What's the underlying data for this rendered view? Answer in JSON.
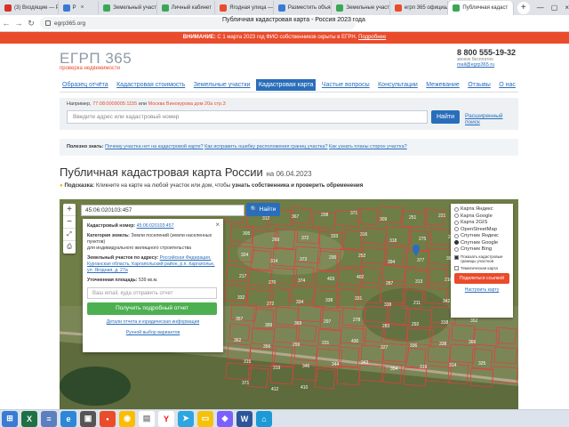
{
  "browser": {
    "tabs": [
      {
        "label": "(3) Входящие — Р",
        "color": "#d93025"
      },
      {
        "label": "Р",
        "color": "#3b79d6"
      },
      {
        "label": "Земельный участ",
        "color": "#3aa757"
      },
      {
        "label": "Личный кабинет",
        "color": "#3aa757"
      },
      {
        "label": "Ягодная улица —",
        "color": "#e94b2b"
      },
      {
        "label": "Разместить объяв",
        "color": "#3b79d6"
      },
      {
        "label": "Земельные участ",
        "color": "#3aa757"
      },
      {
        "label": "егрп 365 официал",
        "color": "#e94b2b"
      },
      {
        "label": "Публичная кадаст",
        "color": "#3aa757",
        "active": true
      }
    ],
    "url": "egrp365.org",
    "page_title": "Публичная кадастровая карта - Россия 2023 года"
  },
  "alert": {
    "prefix": "ВНИМАНИЕ:",
    "text": " С 1 марта 2023 год ФИО собственников скрыты в ЕГРН.",
    "link": "Подробнее"
  },
  "header": {
    "logo": "ЕГРП 365",
    "logo_sub": "проверка недвижимости",
    "phone": "8 800 555-19-32",
    "phone_note": "звонок бесплатно",
    "email": "mail@egrp365.ru"
  },
  "menu": [
    {
      "label": "Образец отчёта"
    },
    {
      "label": "Кадастровая стоимость"
    },
    {
      "label": "Земельные участки"
    },
    {
      "label": "Кадастровая карта",
      "selected": true
    },
    {
      "label": "Частые вопросы"
    },
    {
      "label": "Консультации"
    },
    {
      "label": "Межевание"
    },
    {
      "label": "Отзывы"
    },
    {
      "label": "О нас"
    }
  ],
  "search": {
    "example_prefix": "Например,",
    "example_code": "77:08:0009005:1155",
    "example_or": "или",
    "example_addr": "Москва Винокурова дом 20а стр.3",
    "placeholder": "Введите адрес или кадастровый номер",
    "button": "Найти",
    "advanced": "Расширенный поиск"
  },
  "useful": {
    "label": "Полезно знать:",
    "links": [
      "Почему участка нет на кадастровой карте?",
      "Как исправить ошибку расположения границ участка?",
      "Как узнать планы сторон участка?"
    ]
  },
  "heading": {
    "title": "Публичная кадастровая карта России",
    "date": "на 06.04.2023"
  },
  "hint": {
    "label": "Подсказка:",
    "text": "Кликните на карте на любой участок или дом, чтобы",
    "bold": "узнать собственника и проверить обременения"
  },
  "map": {
    "search_value": "45:06:020103:457",
    "find_button": "Найти",
    "popup": {
      "cad_label": "Кадастровый номер:",
      "cad_value": "45:06:020103:457",
      "category_label": "Категория земель:",
      "category_value": "Земли поселений (земли населенных пунктов)",
      "use": "для индивидуального жилищного строительства",
      "address_label": "Земельный участок по адресу:",
      "address_value": "Российская Федерация, Курганская область, Каргапольский район, р.п. Каргаполье, ул. Ягодная, д. 27а",
      "area_label": "Уточненная площадь:",
      "area_value": "539 кв.м.",
      "phone_placeholder": "Ваш email, куда отправить отчет",
      "report_button": "Получить подробный отчет",
      "details_link": "Детали отчета и юридическая информация",
      "manual_link": "Ручной выбор вариантов"
    },
    "layers": {
      "options": [
        {
          "label": "Карта Яндекс",
          "on": false
        },
        {
          "label": "Карта Google",
          "on": false
        },
        {
          "label": "Карта 2GIS",
          "on": false
        },
        {
          "label": "OpenStreetMap",
          "on": false
        },
        {
          "label": "Спутник Яндекс",
          "on": false
        },
        {
          "label": "Спутник Google",
          "on": true
        },
        {
          "label": "Спутник Bing",
          "on": false
        }
      ],
      "show_borders": "Показать кадастровые границы участков",
      "thematic": "Тематическая карта",
      "share": "Поделиться ссылкой",
      "configure": "Настроить карту"
    },
    "plot_numbers": [
      "313",
      "312",
      "367",
      "208",
      "371",
      "309",
      "251",
      "221",
      "327",
      "305",
      "269",
      "372",
      "333",
      "316",
      "318",
      "275",
      "293",
      "218",
      "324",
      "314",
      "373",
      "200",
      "252",
      "394",
      "377",
      "397",
      "219",
      "217",
      "270",
      "374",
      "403",
      "402",
      "287",
      "313",
      "216",
      "316",
      "332",
      "272",
      "334",
      "338",
      "331",
      "338",
      "211",
      "342",
      "316",
      "357",
      "399",
      "369",
      "297",
      "278",
      "283",
      "292",
      "318",
      "352",
      "362",
      "356",
      "299",
      "231",
      "430",
      "327",
      "336",
      "338",
      "366",
      "315",
      "319",
      "346",
      "344",
      "343",
      "354",
      "319",
      "314",
      "325",
      "371",
      "412",
      "410"
    ]
  }
}
